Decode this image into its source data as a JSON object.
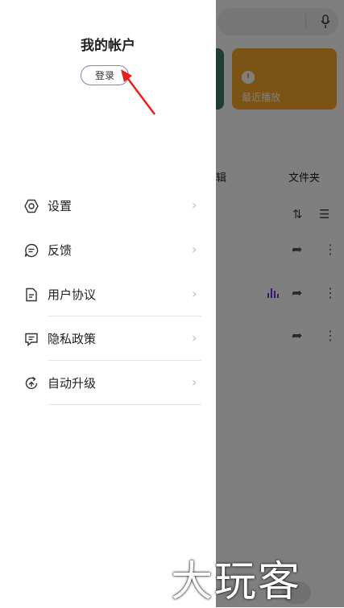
{
  "drawer": {
    "title": "我的帐户",
    "login_label": "登录",
    "menu": [
      {
        "label": "设置",
        "icon": "settings-hexagon-icon"
      },
      {
        "label": "反馈",
        "icon": "feedback-chat-icon"
      },
      {
        "label": "用户协议",
        "icon": "document-icon"
      },
      {
        "label": "隐私政策",
        "icon": "privacy-note-icon"
      },
      {
        "label": "自动升级",
        "icon": "auto-update-icon"
      }
    ],
    "chevron": "›"
  },
  "background": {
    "recent_card_label": "最近播放",
    "tab_partial": "辑",
    "tab_folder": "文件夹",
    "colors": {
      "recent_card": "#f4a62a",
      "green_card": "#3f7d64",
      "playing": "#6a2fd6"
    }
  },
  "annotation": {
    "arrow_color": "#e8211b"
  },
  "watermark": "大玩客"
}
